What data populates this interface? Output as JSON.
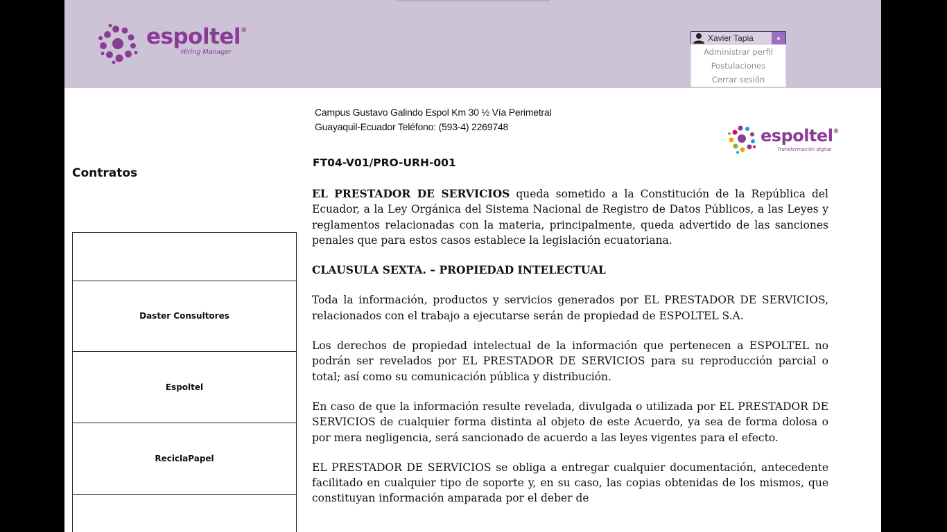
{
  "header": {
    "logo_text": "espoltel",
    "logo_subtitle": "Hiring Manager",
    "user": {
      "name": "Xavier Tapia",
      "menu": [
        {
          "label": "Administrar perfil"
        },
        {
          "label": "Postulaciones"
        },
        {
          "label": "Cerrar sesión"
        }
      ]
    }
  },
  "sidebar": {
    "title": "Contratos",
    "items": [
      {
        "label": ""
      },
      {
        "label": "Daster Consultores"
      },
      {
        "label": "Espoltel"
      },
      {
        "label": "ReciclaPapel"
      },
      {
        "label": ""
      }
    ]
  },
  "document": {
    "address_line1": "Campus Gustavo Galindo Espol Km 30 ½ Vía Perimetral",
    "address_line2": "Guayaquil-Ecuador Teléfono: (593-4) 2269748",
    "logo_text": "espoltel",
    "logo_subtitle": "Transformación digital",
    "code": "FT04-V01/PRO-URH-001",
    "p1_lead": "EL PRESTADOR DE SERVICIOS",
    "p1_rest": " queda sometido a la Constitución de la República del Ecuador, a la Ley Orgánica del Sistema Nacional de Registro de Datos Públicos, a las Leyes y reglamentos relacionadas con la materia, principalmente, queda advertido de las sanciones penales que para estos casos establece la legislación ecuatoriana.",
    "heading": "CLAUSULA SEXTA. – PROPIEDAD INTELECTUAL",
    "p2": "Toda la información, productos y servicios generados por EL PRESTADOR DE SERVICIOS, relacionados con el trabajo a ejecutarse serán de propiedad de ESPOLTEL S.A.",
    "p3": "Los derechos de propiedad intelectual de la información que pertenecen a ESPOLTEL no podrán ser revelados por EL PRESTADOR DE SERVICIOS para su reproducción parcial o total; así como su comunicación pública y distribución.",
    "p4": "En caso de que la información resulte revelada, divulgada o utilizada por EL PRESTADOR DE SERVICIOS de cualquier forma distinta al objeto de este Acuerdo, ya sea de forma dolosa o por mera negligencia, será sancionado de acuerdo a las leyes vigentes para el efecto.",
    "p5": "EL PRESTADOR DE SERVICIOS se obliga a entregar cualquier documentación, antecedente facilitado en cualquier tipo de soporte y, en su caso, las copias obtenidas de los mismos, que constituyan información amparada por el deber de"
  },
  "colors": {
    "header_bg": "#cdc3d7",
    "brand": "#8a3b93",
    "toggle": "#9a6fc0"
  }
}
